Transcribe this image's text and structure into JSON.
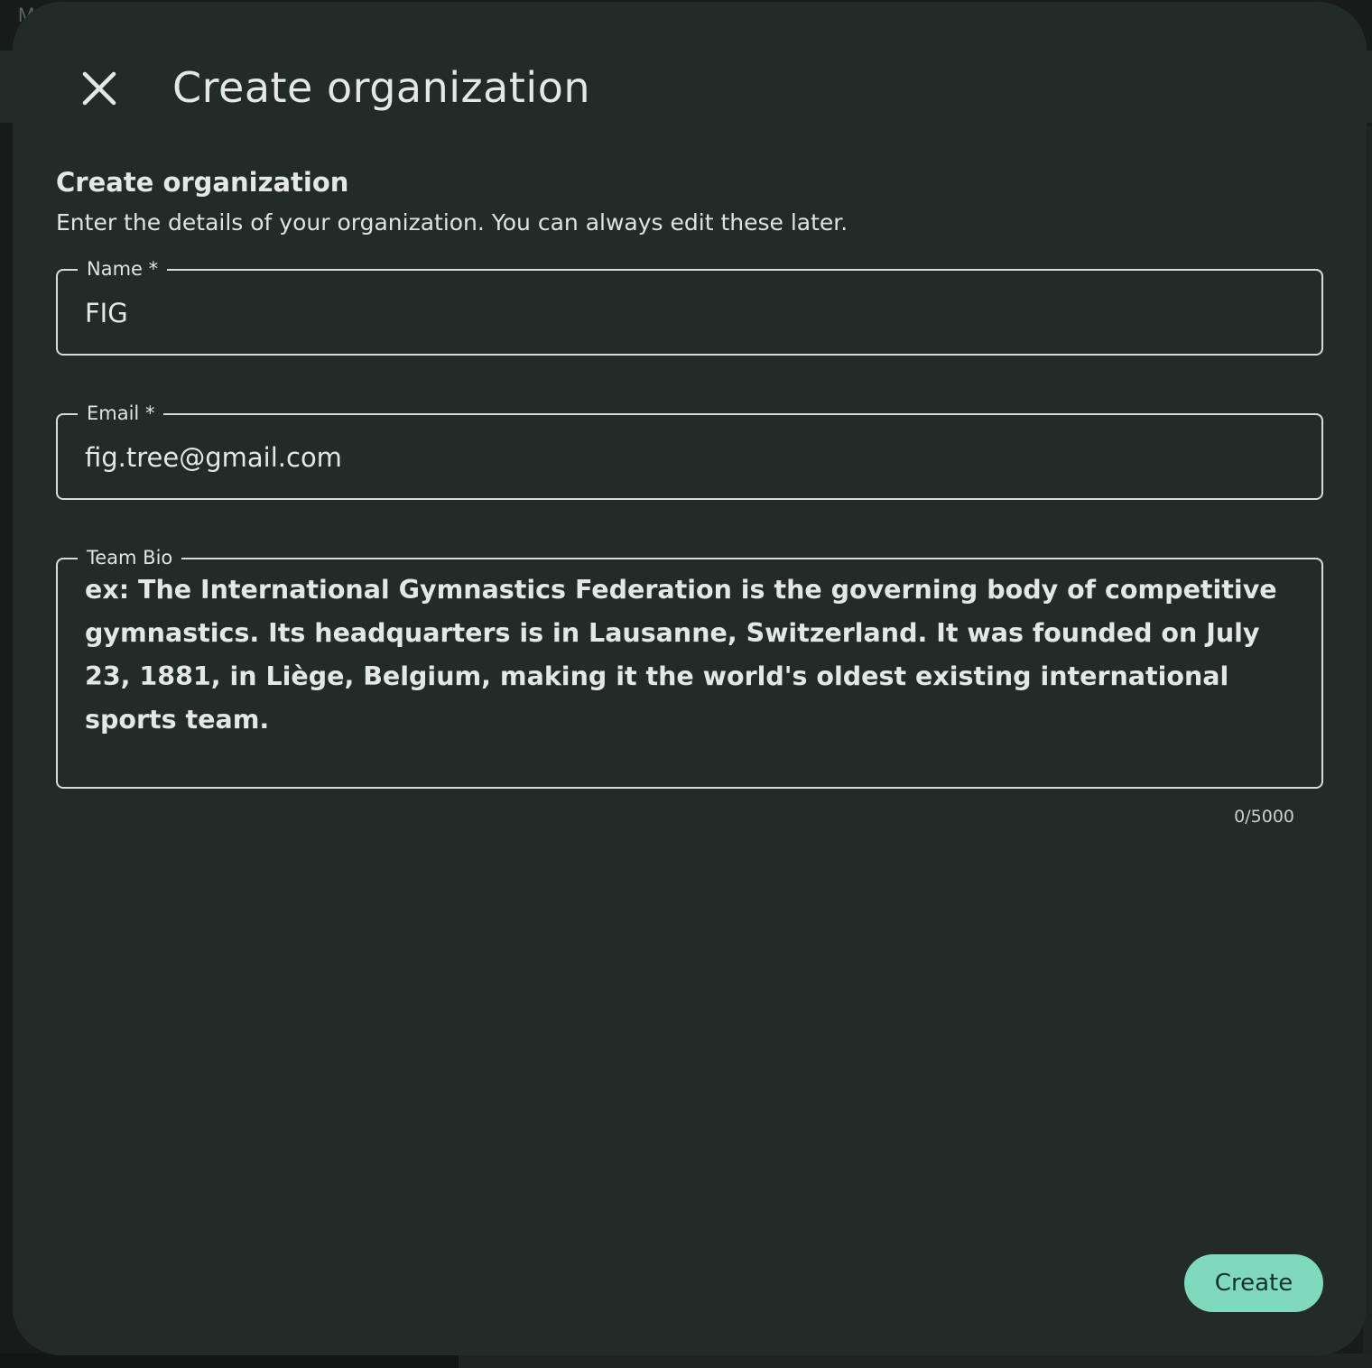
{
  "background": {
    "app_text": "M"
  },
  "dialog": {
    "title": "Create organization",
    "close_icon": "close-icon",
    "section_title": "Create organization",
    "section_subtitle": "Enter the details of your organization. You can always edit these later.",
    "fields": {
      "name": {
        "label": "Name *",
        "value": "FIG"
      },
      "email": {
        "label": "Email *",
        "value": "fig.tree@gmail.com"
      },
      "bio": {
        "label": "Team Bio",
        "placeholder": "ex: The International Gymnastics Federation is the governing body of competitive gymnastics. Its headquarters is in Lausanne, Switzerland. It was founded on July 23, 1881, in Liège, Belgium, making it the world's oldest existing international sports team.",
        "counter": "0/5000"
      }
    },
    "create_label": "Create"
  },
  "colors": {
    "dialog_bg": "#232b29",
    "accent": "#7fd9bd",
    "text": "#e3e7e5"
  }
}
